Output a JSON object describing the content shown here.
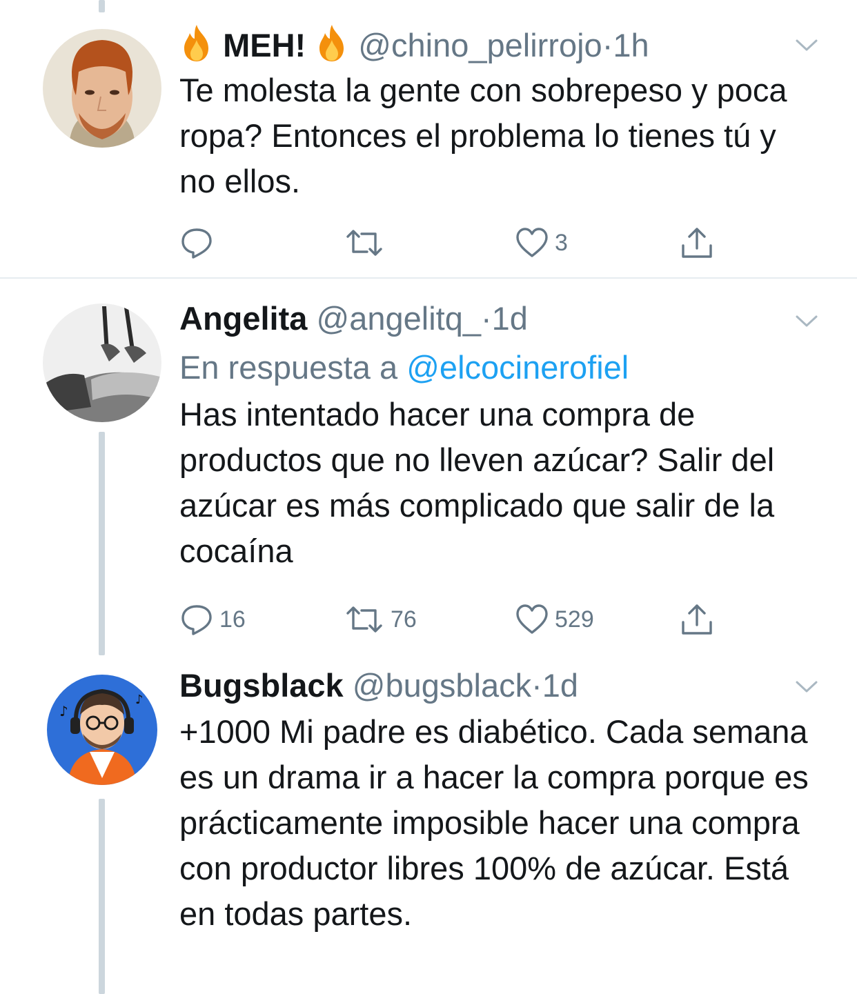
{
  "tweets": [
    {
      "display_name": "MEH!",
      "handle": "@chino_pelirrojo",
      "separator": "·",
      "time": "1h",
      "reply_to_prefix": "",
      "reply_to_mention": "",
      "text": "Te molesta la gente con sobrepeso y poca ropa? Entonces el problema lo tienes tú y no ellos.",
      "reply_count": "",
      "retweet_count": "",
      "like_count": "3",
      "icons": {
        "name_emoji": "fire-emoji",
        "caret": "chevron-down-icon",
        "reply": "reply-icon",
        "retweet": "retweet-icon",
        "like": "heart-icon",
        "share": "share-icon"
      }
    },
    {
      "display_name": "Angelita",
      "handle": "@angelitq_",
      "separator": "·",
      "time": "1d",
      "reply_to_prefix": "En respuesta a ",
      "reply_to_mention": "@elcocinerofiel",
      "text": "Has intentado hacer una compra de productos que no lleven azúcar? Salir del azúcar es más complicado que salir de la cocaína",
      "reply_count": "16",
      "retweet_count": "76",
      "like_count": "529"
    },
    {
      "display_name": "Bugsblack",
      "handle": "@bugsblack",
      "separator": "·",
      "time": "1d",
      "reply_to_prefix": "",
      "reply_to_mention": "",
      "text": "+1000 Mi padre es diabético. Cada semana es un drama ir a hacer la compra porque es prácticamente imposible hacer una compra con productor libres 100% de azúcar. Está en todas partes.",
      "reply_count": "",
      "retweet_count": "",
      "like_count": ""
    }
  ],
  "colors": {
    "text": "#14171a",
    "secondary": "#657786",
    "link": "#1da1f2",
    "thread_line": "#ccd6dd",
    "divider": "#e6ecf0"
  }
}
